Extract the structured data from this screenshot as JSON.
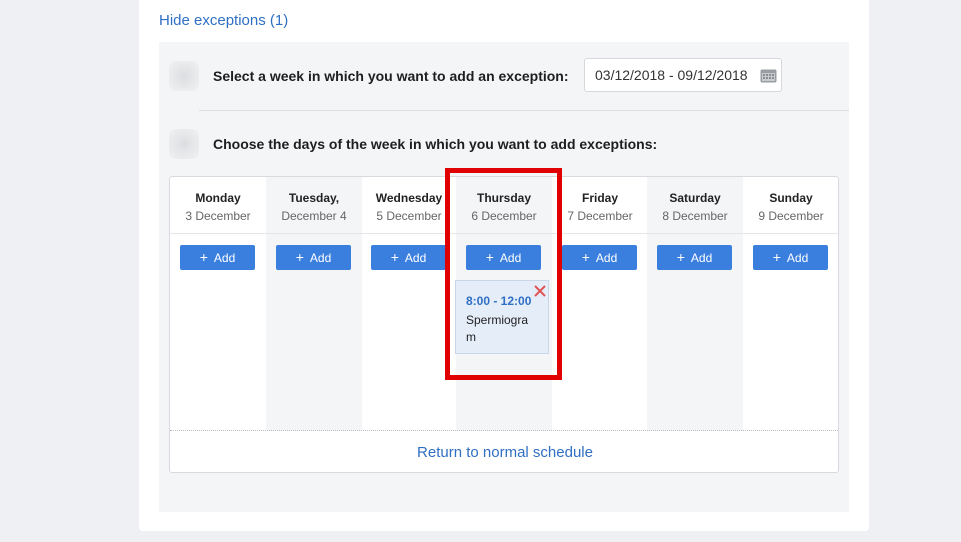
{
  "exceptions_toggle": {
    "label": "Hide exceptions (1)"
  },
  "step1": {
    "label": "Select a week in which you want to add an exception:",
    "week_range": "03/12/2018 - 09/12/2018",
    "icon": "calendar-icon"
  },
  "step2": {
    "label": "Choose the days of the week in which you want to add exceptions:"
  },
  "days": [
    {
      "name": "Monday",
      "date": "3 December"
    },
    {
      "name": "Tuesday,",
      "date": "December 4"
    },
    {
      "name": "Wednesday",
      "date": "5 December"
    },
    {
      "name": "Thursday",
      "date": "6 December"
    },
    {
      "name": "Friday",
      "date": "7 December"
    },
    {
      "name": "Saturday",
      "date": "8 December"
    },
    {
      "name": "Sunday",
      "date": "9 December"
    }
  ],
  "add_button": {
    "label": "Add",
    "icon": "plus-icon"
  },
  "exception": {
    "day": "Thursday",
    "time": "8:00 - 12:00",
    "name": "Spermiogram",
    "close_icon": "close-icon"
  },
  "return_link": {
    "label": "Return to normal schedule"
  },
  "colors": {
    "link": "#2f6fc4",
    "button": "#3b7fde",
    "highlight": "#e00000",
    "close": "#e05555",
    "exception_bg": "#e4edf8"
  }
}
